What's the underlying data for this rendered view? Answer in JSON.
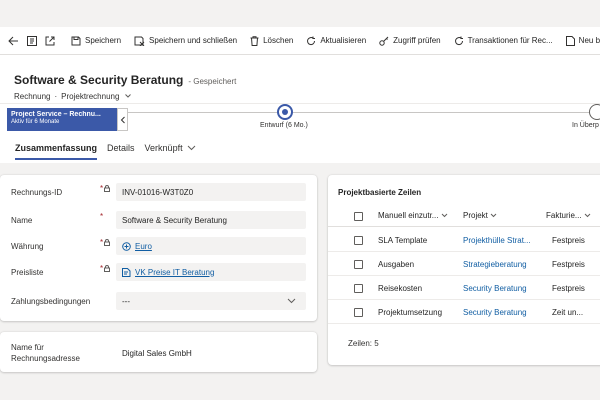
{
  "toolbar": {
    "save": "Speichern",
    "save_close": "Speichern und schließen",
    "delete": "Löschen",
    "refresh": "Aktualisieren",
    "check_access": "Zugriff prüfen",
    "transactions": "Transaktionen für Rec...",
    "new": "Neu be"
  },
  "header": {
    "title": "Software & Security Beratung",
    "status": "- Gespeichert",
    "entity": "Rechnung",
    "form": "Projektrechnung"
  },
  "bpf": {
    "process_name": "Project Service – Rechnu...",
    "active_for": "Aktiv für 6 Monate",
    "stage_current": "Entwurf  (6 Mo.)",
    "stage_next": "In Überp"
  },
  "tabs": [
    {
      "label": "Zusammenfassung"
    },
    {
      "label": "Details"
    },
    {
      "label": "Verknüpft"
    }
  ],
  "form": {
    "invoice_id_label": "Rechnungs-ID",
    "invoice_id_value": "INV-01016-W3T0Z0",
    "name_label": "Name",
    "name_value": "Software & Security Beratung",
    "currency_label": "Währung",
    "currency_value": "Euro",
    "pricelist_label": "Preisliste",
    "pricelist_value": "VK Preise IT Beratung",
    "payment_label": "Zahlungsbedingungen",
    "payment_value": "---",
    "billing_label": "Name für Rechnungsadresse",
    "billing_value": "Digital Sales GmbH"
  },
  "grid": {
    "title": "Projektbasierte Zeilen",
    "columns": [
      "Manuell einzutr...",
      "Projekt",
      "Fakturie..."
    ],
    "rows": [
      {
        "name": "SLA Template",
        "project": "Projekthülle Strat...",
        "billing": "Festpreis"
      },
      {
        "name": "Ausgaben",
        "project": "Strategieberatung",
        "billing": "Festpreis"
      },
      {
        "name": "Reisekosten",
        "project": "Security Beratung",
        "billing": "Festpreis"
      },
      {
        "name": "Projektumsetzung",
        "project": "Security Beratung",
        "billing": "Zeit un..."
      }
    ],
    "footer": "Zeilen: 5"
  },
  "colors": {
    "accent": "#3b59a8",
    "link": "#115ea3",
    "required": "#a4262c"
  }
}
